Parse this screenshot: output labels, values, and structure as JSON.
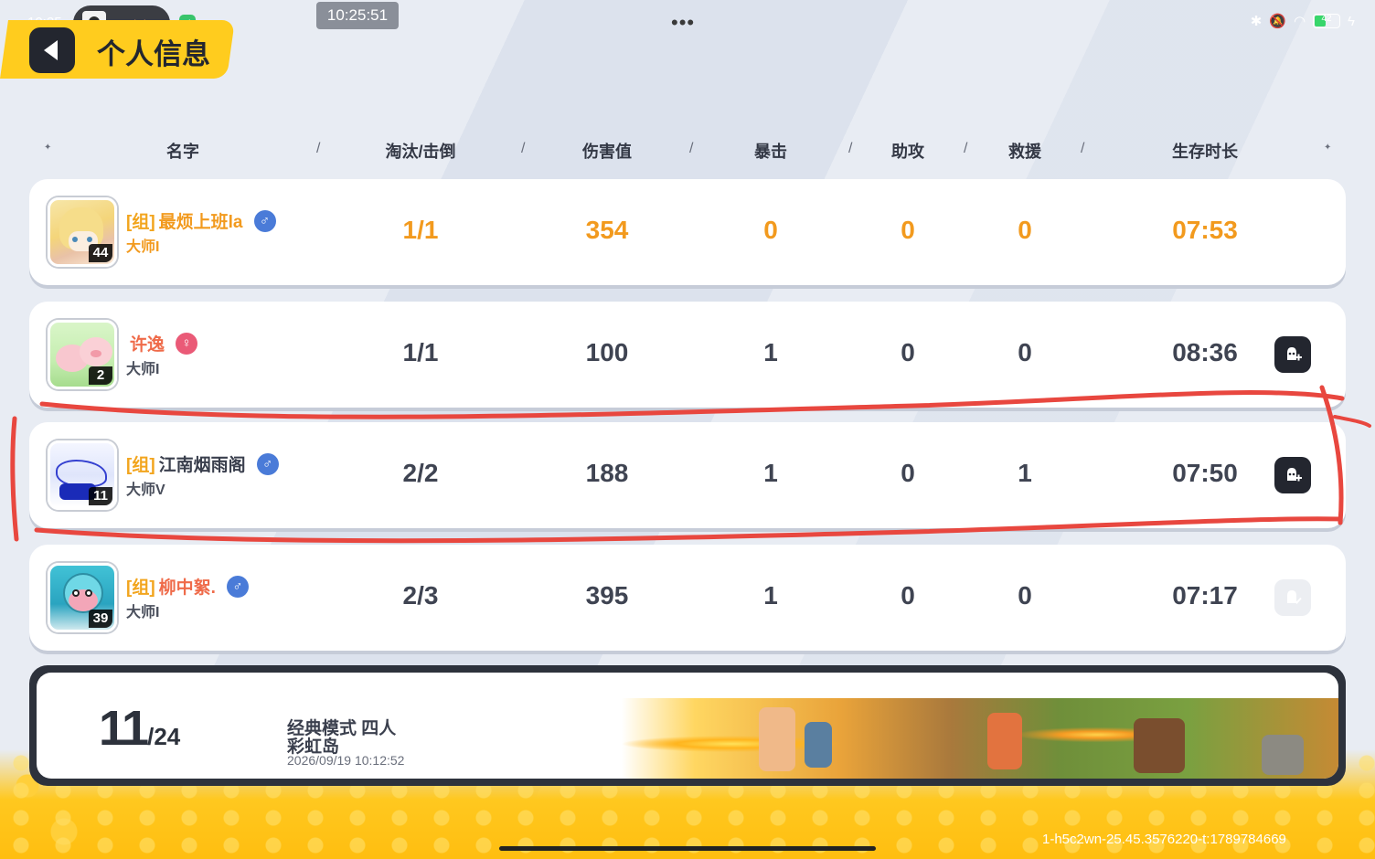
{
  "status_bar": {
    "time_left": "10:25",
    "clock": "10:25:51",
    "battery": "42",
    "menu_dots": "•••"
  },
  "header": {
    "title": "个人信息"
  },
  "columns": {
    "name": "名字",
    "kills": "淘汰/击倒",
    "damage": "伤害值",
    "crit": "暴击",
    "assist": "助攻",
    "rescue": "救援",
    "survival": "生存时长",
    "separator": "/"
  },
  "players": [
    {
      "tag": "[组]",
      "name": "最烦上班la",
      "gender": "♂",
      "rank": "大师I",
      "level": "44",
      "kills": "1/1",
      "damage": "354",
      "crit": "0",
      "assist": "0",
      "rescue": "0",
      "survival": "07:53"
    },
    {
      "tag": "",
      "name": "许逸",
      "gender": "♀",
      "rank": "大师I",
      "level": "2",
      "kills": "1/1",
      "damage": "100",
      "crit": "1",
      "assist": "0",
      "rescue": "0",
      "survival": "08:36"
    },
    {
      "tag": "[组]",
      "name": "江南烟雨阁",
      "gender": "♂",
      "rank": "大师V",
      "level": "11",
      "kills": "2/2",
      "damage": "188",
      "crit": "1",
      "assist": "0",
      "rescue": "1",
      "survival": "07:50"
    },
    {
      "tag": "[组]",
      "name": "柳中絮.",
      "gender": "♂",
      "rank": "大师I",
      "level": "39",
      "kills": "2/3",
      "damage": "395",
      "crit": "1",
      "assist": "0",
      "rescue": "0",
      "survival": "07:17"
    }
  ],
  "match": {
    "placement": "11",
    "total": "/24",
    "mode": "经典模式 四人",
    "map": "彩虹岛",
    "datetime": "2026/09/19 10:12:52"
  },
  "footer": {
    "id": "1-h5c2wn-25.45.3576220-t:1789784669"
  },
  "colors": {
    "accent_yellow": "#ffcc1e",
    "highlight_orange": "#f29a1e",
    "dark": "#23262f",
    "annotation_red": "#e8473f"
  }
}
